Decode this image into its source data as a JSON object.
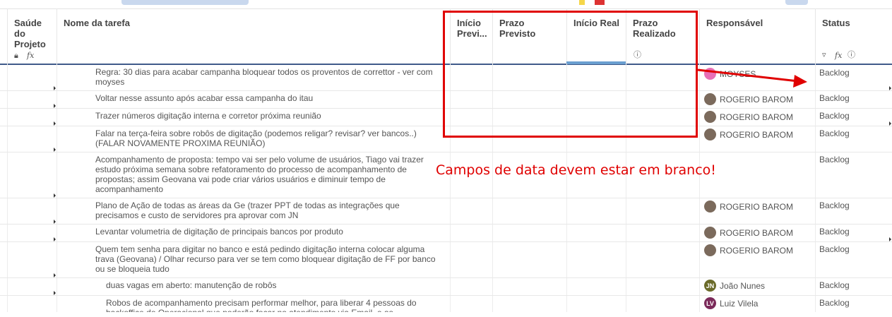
{
  "columns": {
    "saude": "Saúde do Projeto",
    "nome": "Nome da tarefa",
    "inicio_previsto": "Início Previ...",
    "prazo_previsto": "Prazo Previsto",
    "inicio_real": "Início Real",
    "prazo_realizado": "Prazo Realizado",
    "responsavel": "Responsável",
    "status": "Status"
  },
  "rows": [
    {
      "task": "Regra: 30 dias para acabar campanha bloquear todos os proventos de correttor - ver com moyses",
      "resp": "MOYSES",
      "status": "Backlog"
    },
    {
      "task": "Voltar nesse assunto após acabar essa campanha do itau",
      "resp": "ROGERIO BAROM",
      "status": "Backlog"
    },
    {
      "task": "Trazer números digitação interna e corretor próxima reunião",
      "resp": "ROGERIO BAROM",
      "status": "Backlog"
    },
    {
      "task": "Falar na terça-feira sobre robôs de digitação (podemos religar? revisar? ver bancos..) (FALAR NOVAMENTE PROXIMA REUNIÃO)",
      "resp": "ROGERIO BAROM",
      "status": "Backlog"
    },
    {
      "task": "Acompanhamento de proposta: tempo vai ser pelo volume de usuários, Tiago vai trazer estudo próxima semana sobre refatoramento do processo de acompanhamento de propostas; assim Geovana vai pode criar vários usuários e diminuir tempo de acompanhamento",
      "resp": "",
      "status": "Backlog"
    },
    {
      "task": "Plano de Ação de todas as áreas da Ge (trazer PPT de todas as integrações que precisamos e custo de servidores pra aprovar com JN",
      "resp": "ROGERIO BAROM",
      "status": "Backlog"
    },
    {
      "task": "Levantar volumetria de digitação de principais bancos por produto",
      "resp": "ROGERIO BAROM",
      "status": "Backlog"
    },
    {
      "task": "Quem tem senha para digitar no banco e está pedindo digitação interna colocar alguma trava (Geovana) / Olhar recurso para ver se tem como bloquear digitação de FF por banco ou se bloqueia tudo",
      "resp": "ROGERIO BAROM",
      "status": "Backlog"
    },
    {
      "task": "duas vagas em aberto: manutenção de robôs",
      "resp": "João Nunes",
      "initials": "JN",
      "status": "Backlog"
    },
    {
      "task": "Robos de acompanhamento precisam performar melhor, para liberar 4 pessoas do backoffice do Operacional que poderão focar no atendimento via Email, e as",
      "resp": "Luiz Vilela",
      "initials": "LV",
      "status": "Backlog"
    }
  ],
  "annotation": "Campos de data devem estar em branco!",
  "colors": {
    "red": "#e00000",
    "header_line": "#3f5a8a",
    "accent_underline": "#6a9fd0"
  }
}
